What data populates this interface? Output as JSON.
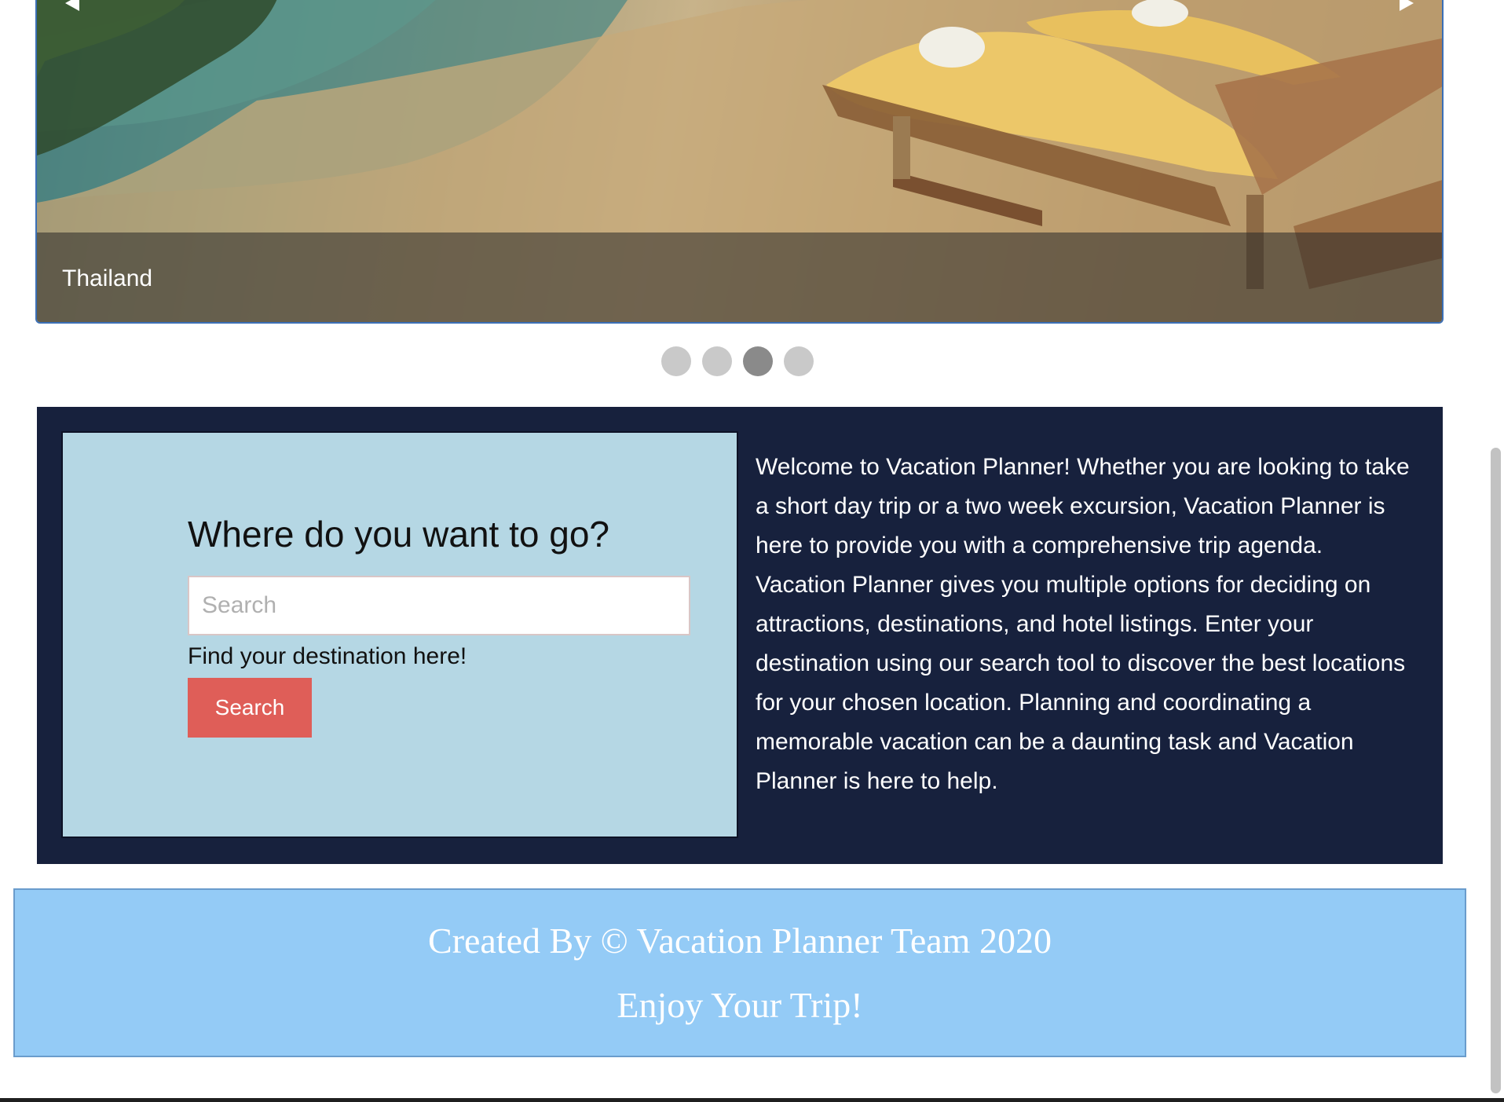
{
  "carousel": {
    "caption": "Thailand",
    "slide_count": 4,
    "active_index": 2
  },
  "search": {
    "title": "Where do you want to go?",
    "placeholder": "Search",
    "value": "",
    "hint": "Find your destination here!",
    "button_label": "Search"
  },
  "welcome": {
    "text": "Welcome to Vacation Planner! Whether you are looking to take a short day trip or a two week excursion, Vacation Planner is here to provide you with a comprehensive trip agenda. Vacation Planner gives you multiple options for deciding on attractions, destinations, and hotel listings. Enter your destination using our search tool to discover the best locations for your chosen location. Planning and coordinating a memorable vacation can be a daunting task and Vacation Planner is here to help."
  },
  "footer": {
    "credit": "Created By © Vacation Planner Team 2020",
    "tagline": "Enjoy Your Trip!"
  },
  "colors": {
    "info_background": "#17213d",
    "search_panel": "#b5d7e4",
    "search_button": "#df5e58",
    "footer_background": "#94cbf6",
    "indicator_active": "#8a8a8a",
    "indicator_inactive": "#c9c9c9"
  },
  "icons": {
    "prev": "chevron-left-icon",
    "next": "chevron-right-icon"
  }
}
